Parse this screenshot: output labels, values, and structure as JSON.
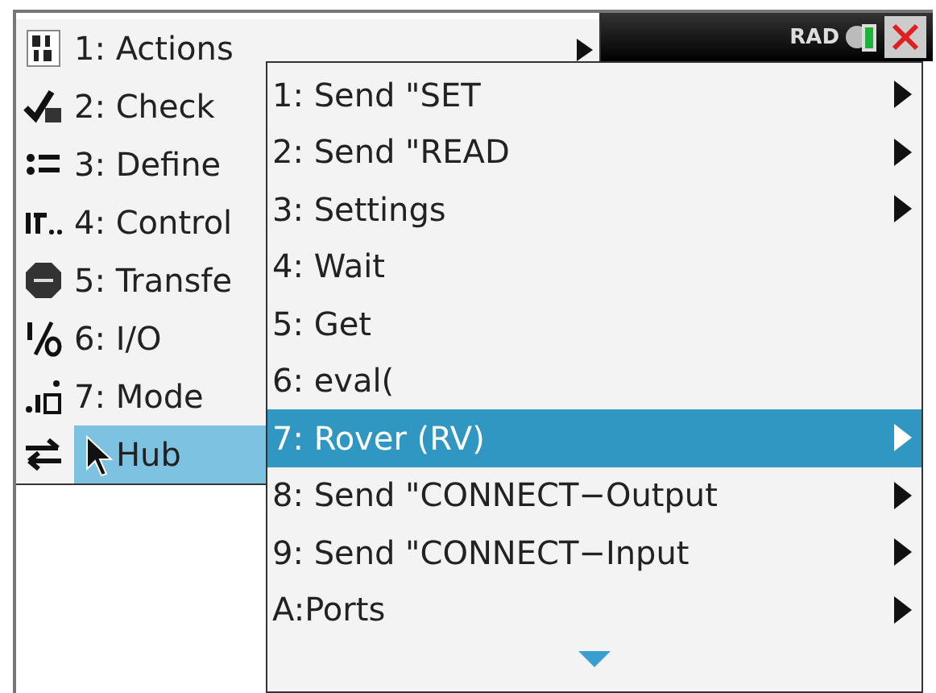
{
  "status_bar": {
    "angle_mode": "RAD"
  },
  "menu": {
    "items": [
      {
        "label": "1: Actions",
        "kind": "digits",
        "selected": false,
        "has_submenu": true
      },
      {
        "label": "2: Check",
        "kind": "check",
        "selected": false
      },
      {
        "label": "3: Define",
        "kind": "define",
        "selected": false
      },
      {
        "label": "4: Control",
        "kind": "control",
        "selected": false
      },
      {
        "label": "5: Transfe",
        "kind": "stop",
        "selected": false
      },
      {
        "label": "6: I/O",
        "kind": "io",
        "selected": false
      },
      {
        "label": "7: Mode",
        "kind": "mode",
        "selected": false
      },
      {
        "label": "Hub",
        "kind": "hub",
        "selected": true
      }
    ]
  },
  "submenu": {
    "items": [
      {
        "label": "1: Send \"SET",
        "selected": false,
        "has_submenu": true
      },
      {
        "label": "2: Send \"READ",
        "selected": false,
        "has_submenu": true
      },
      {
        "label": "3: Settings",
        "selected": false,
        "has_submenu": true
      },
      {
        "label": "4: Wait",
        "selected": false,
        "has_submenu": false
      },
      {
        "label": "5: Get",
        "selected": false,
        "has_submenu": false
      },
      {
        "label": "6: eval(",
        "selected": false,
        "has_submenu": false
      },
      {
        "label": "7: Rover (RV)",
        "selected": true,
        "has_submenu": true
      },
      {
        "label": "8: Send \"CONNECT−Output",
        "selected": false,
        "has_submenu": true
      },
      {
        "label": "9: Send \"CONNECT−Input",
        "selected": false,
        "has_submenu": true
      },
      {
        "label": "A:Ports",
        "selected": false,
        "has_submenu": true
      }
    ],
    "more_below": true
  }
}
